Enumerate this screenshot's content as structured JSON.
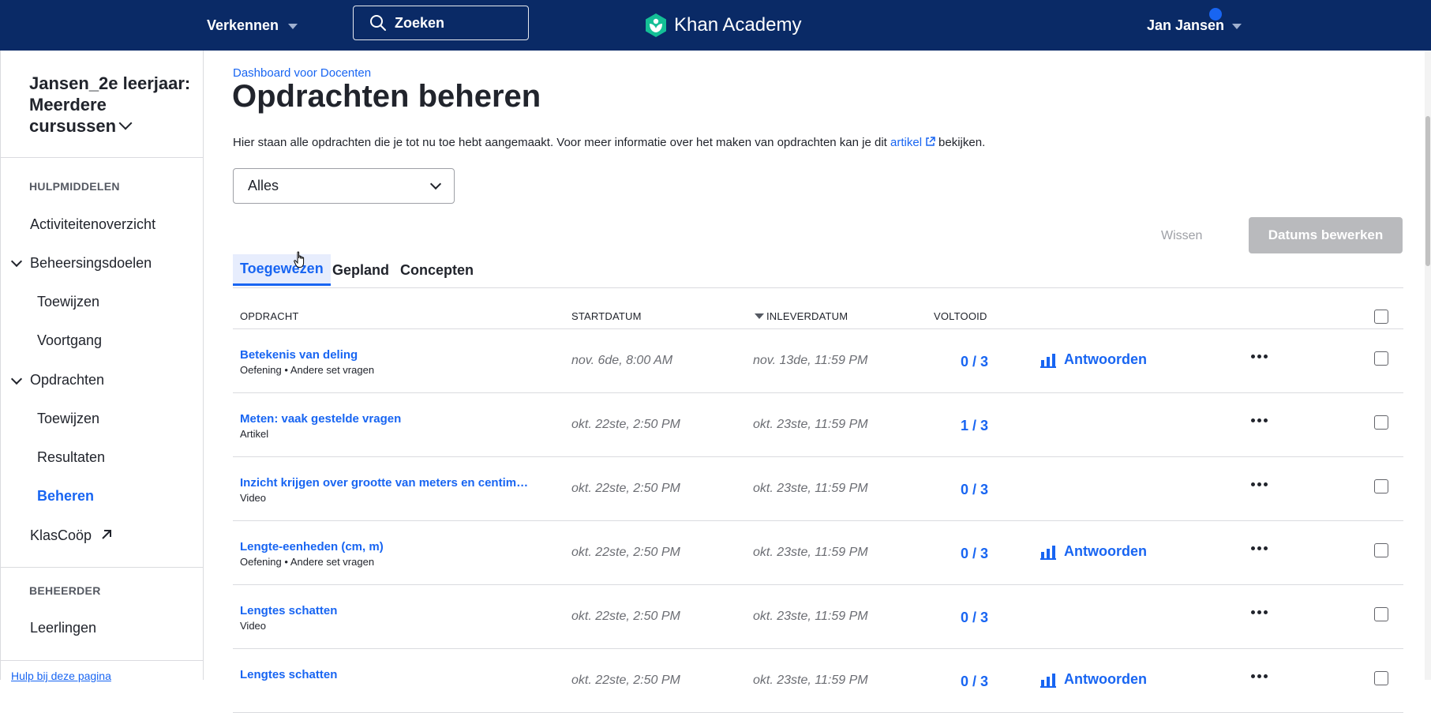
{
  "header": {
    "explore_label": "Verkennen",
    "search_label": "Zoeken",
    "brand": "Khan Academy",
    "user_name": "Jan Jansen",
    "colors": {
      "nav_bg": "#0a2a66",
      "brand_green": "#14bf96",
      "accent": "#1865f2",
      "notification": "#1865f2"
    }
  },
  "sidebar": {
    "class_title": "Jansen_2e leerjaar: Meerdere cursussen",
    "section_tools": "HULPMIDDELEN",
    "activity_overview": "Activiteitenoverzicht",
    "mastery_goals": "Beheersingsdoelen",
    "mastery_assign": "Toewijzen",
    "mastery_progress": "Voortgang",
    "assignments": "Opdrachten",
    "assignments_assign": "Toewijzen",
    "assignments_results": "Resultaten",
    "assignments_manage": "Beheren",
    "klascoop": "KlasCoöp",
    "section_admin": "BEHEERDER",
    "students": "Leerlingen",
    "help_link": "Hulp bij deze pagina"
  },
  "main": {
    "breadcrumb": "Dashboard voor Docenten",
    "title": "Opdrachten beheren",
    "description_before": "Hier staan alle opdrachten die je tot nu toe hebt aangemaakt. Voor meer informatie over het maken van opdrachten kan je dit",
    "description_link": "artikel",
    "description_after": "bekijken.",
    "filter_value": "Alles",
    "clear_label": "Wissen",
    "edit_dates_label": "Datums bewerken",
    "tabs": [
      {
        "label": "Toegewezen",
        "selected": true
      },
      {
        "label": "Gepland",
        "selected": false
      },
      {
        "label": "Concepten",
        "selected": false
      }
    ],
    "table": {
      "headers": {
        "assignment": "OPDRACHT",
        "start": "STARTDATUM",
        "due": "INLEVERDATUM",
        "done": "VOLTOOID"
      },
      "rows": [
        {
          "title": "Betekenis van deling",
          "subtitle": "Oefening • Andere set vragen",
          "start": "nov. 6de, 8:00 AM",
          "due": "nov. 13de, 11:59 PM",
          "done": "0 / 3",
          "answers": "Antwoorden"
        },
        {
          "title": "Meten: vaak gestelde vragen",
          "subtitle": "Artikel",
          "start": "okt. 22ste, 2:50 PM",
          "due": "okt. 23ste, 11:59 PM",
          "done": "1 / 3",
          "answers": ""
        },
        {
          "title": "Inzicht krijgen over grootte van meters en centim…",
          "subtitle": "Video",
          "start": "okt. 22ste, 2:50 PM",
          "due": "okt. 23ste, 11:59 PM",
          "done": "0 / 3",
          "answers": ""
        },
        {
          "title": "Lengte-eenheden (cm, m)",
          "subtitle": "Oefening • Andere set vragen",
          "start": "okt. 22ste, 2:50 PM",
          "due": "okt. 23ste, 11:59 PM",
          "done": "0 / 3",
          "answers": "Antwoorden"
        },
        {
          "title": "Lengtes schatten",
          "subtitle": "Video",
          "start": "okt. 22ste, 2:50 PM",
          "due": "okt. 23ste, 11:59 PM",
          "done": "0 / 3",
          "answers": ""
        },
        {
          "title": "Lengtes schatten",
          "subtitle": "",
          "start": "okt. 22ste, 2:50 PM",
          "due": "okt. 23ste, 11:59 PM",
          "done": "0 / 3",
          "answers": "Antwoorden"
        }
      ]
    }
  }
}
